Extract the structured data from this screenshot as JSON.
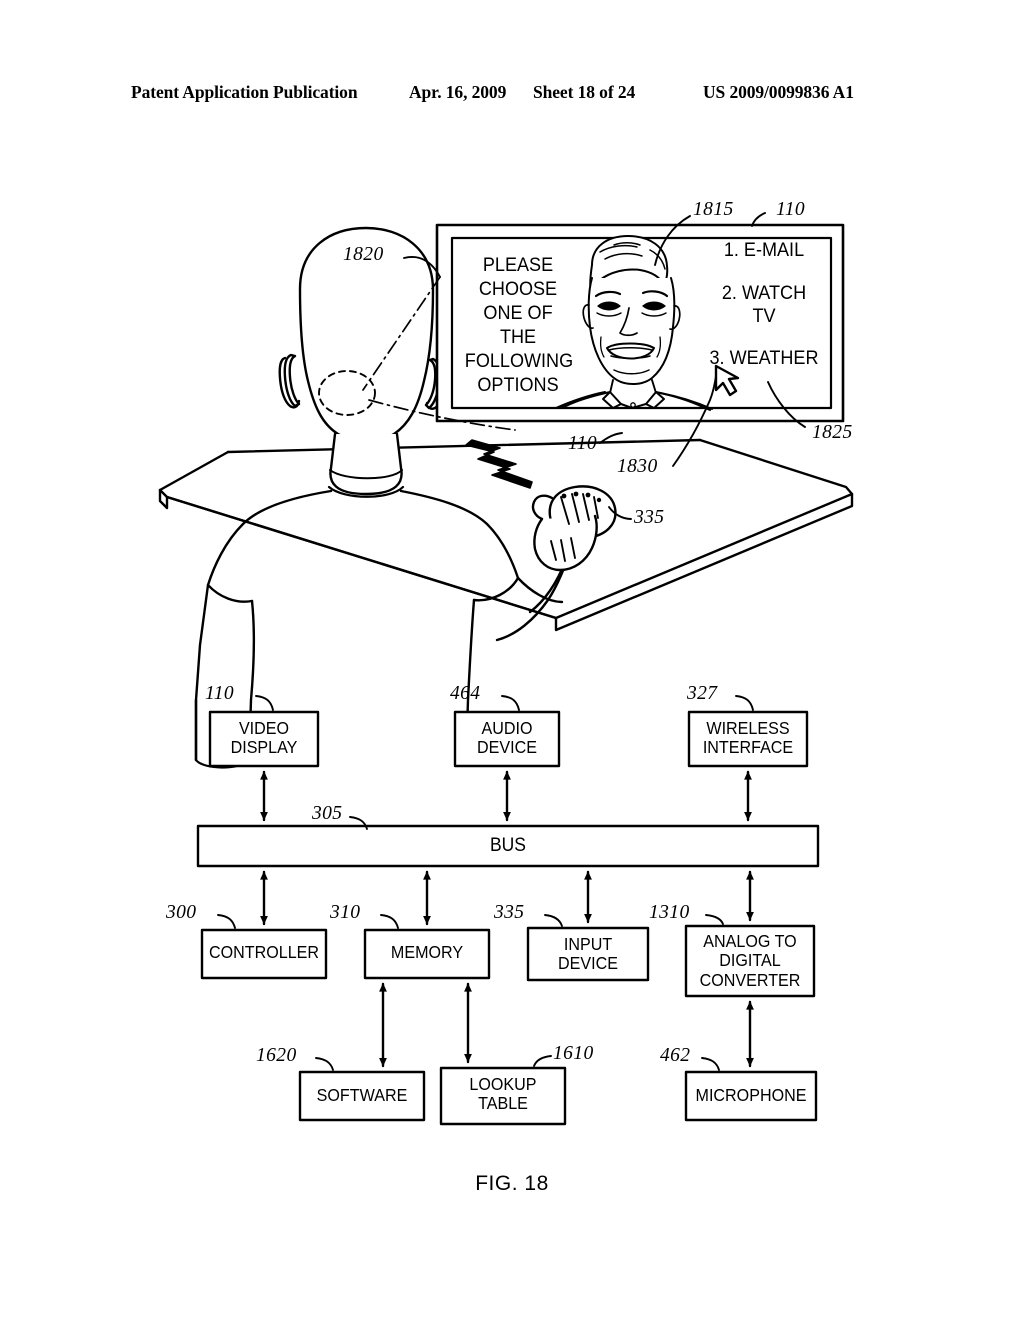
{
  "header": {
    "publication": "Patent Application Publication",
    "date": "Apr. 16, 2009",
    "sheet": "Sheet 18 of 24",
    "patent_number": "US 2009/0099836 A1"
  },
  "figure": {
    "caption": "FIG. 18"
  },
  "screen": {
    "prompt": "PLEASE\nCHOOSE\nONE OF\nTHE\nFOLLOWING\nOPTIONS",
    "options": [
      "1. E-MAIL",
      "2. WATCH\nTV",
      "3. WEATHER"
    ]
  },
  "scene_refs": [
    {
      "id": "ref-1820",
      "label": "1820"
    },
    {
      "id": "ref-1815",
      "label": "1815"
    },
    {
      "id": "ref-110-screen",
      "label": "110"
    },
    {
      "id": "ref-110-desk",
      "label": "110"
    },
    {
      "id": "ref-1830",
      "label": "1830"
    },
    {
      "id": "ref-1825",
      "label": "1825"
    },
    {
      "id": "ref-335-mouse",
      "label": "335"
    }
  ],
  "block_diagram": {
    "blocks": [
      {
        "id": "video-display",
        "ref": "110",
        "label": "VIDEO\nDISPLAY"
      },
      {
        "id": "audio-device",
        "ref": "464",
        "label": "AUDIO\nDEVICE"
      },
      {
        "id": "wireless-interface",
        "ref": "327",
        "label": "WIRELESS\nINTERFACE"
      },
      {
        "id": "bus",
        "ref": "305",
        "label": "BUS"
      },
      {
        "id": "controller",
        "ref": "300",
        "label": "CONTROLLER"
      },
      {
        "id": "memory",
        "ref": "310",
        "label": "MEMORY"
      },
      {
        "id": "input-device",
        "ref": "335",
        "label": "INPUT\nDEVICE"
      },
      {
        "id": "analog-to-digital-converter",
        "ref": "1310",
        "label": "ANALOG TO\nDIGITAL\nCONVERTER"
      },
      {
        "id": "software",
        "ref": "1620",
        "label": "SOFTWARE"
      },
      {
        "id": "lookup-table",
        "ref": "1610",
        "label": "LOOKUP\nTABLE"
      },
      {
        "id": "microphone",
        "ref": "462",
        "label": "MICROPHONE"
      }
    ]
  },
  "colors": {
    "ink": "#000000",
    "paper": "#ffffff"
  }
}
